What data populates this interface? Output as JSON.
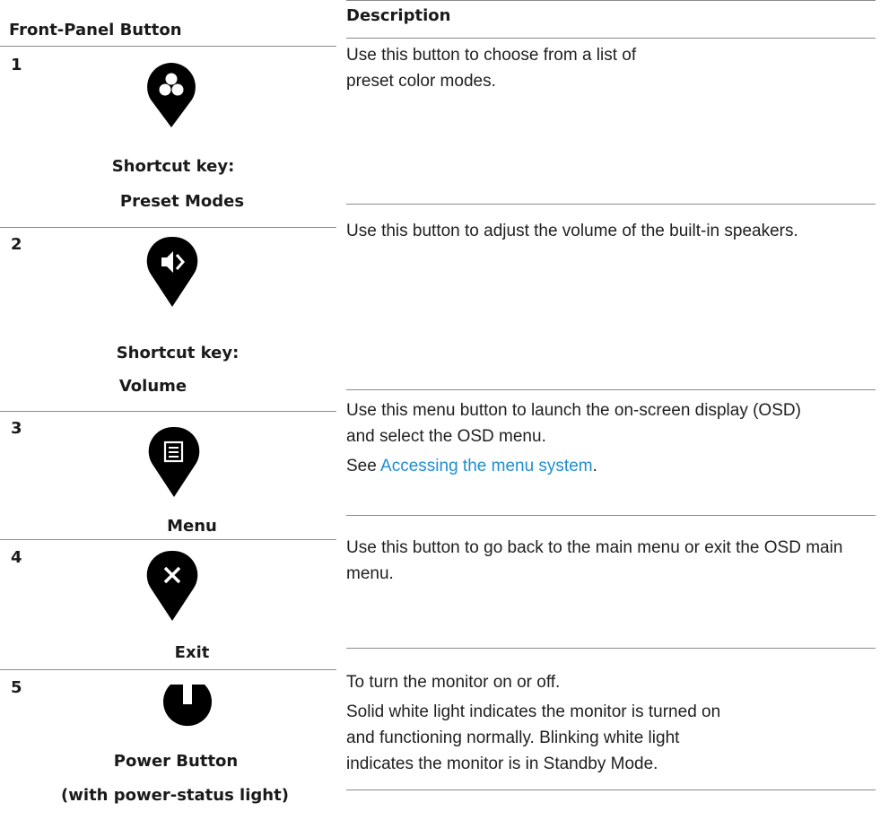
{
  "header": {
    "col1": "Front-Panel Button",
    "col2": "Description"
  },
  "rows": [
    {
      "number": "1",
      "icon": "preset-modes-icon",
      "caption_lines": [
        "Shortcut key:",
        "Preset Modes"
      ],
      "description": [
        "Use this button to choose from a list of preset color modes."
      ]
    },
    {
      "number": "2",
      "icon": "volume-icon",
      "caption_lines": [
        "Shortcut key:",
        "Volume"
      ],
      "description": [
        "Use this button to adjust the volume of the built-in speakers."
      ]
    },
    {
      "number": "3",
      "icon": "menu-icon",
      "caption_lines": [
        "Menu"
      ],
      "description": [
        "Use this menu button to launch the on-screen display (OSD) and select the OSD menu."
      ],
      "see_prefix": "See ",
      "link_text": "Accessing the menu system",
      "see_suffix": "."
    },
    {
      "number": "4",
      "icon": "exit-icon",
      "caption_lines": [
        "Exit"
      ],
      "description": [
        "Use this button to go back to the main menu or exit the OSD main menu."
      ]
    },
    {
      "number": "5",
      "icon": "power-icon",
      "caption_lines": [
        "Power Button",
        "(with power-status light)"
      ],
      "description": [
        "To turn the monitor on or off.",
        "Solid white light indicates the monitor is turned on and functioning normally. Blinking white light indicates the monitor is in Standby Mode."
      ]
    }
  ],
  "colors": {
    "text": "#1a1a1a",
    "link": "#1e8fd0",
    "rule": "#8a8a8a",
    "icon": "#000000"
  }
}
